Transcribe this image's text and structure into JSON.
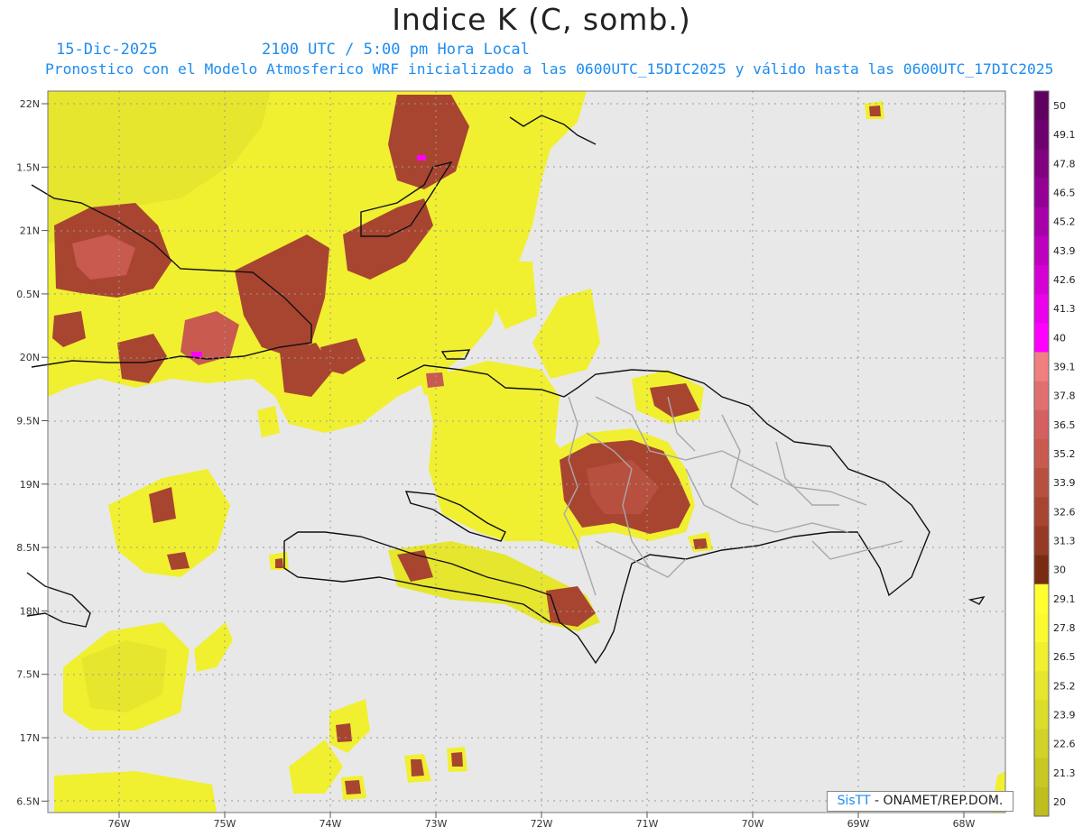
{
  "header": {
    "title": "Indice K (C, somb.)",
    "date": "15-Dic-2025",
    "time": "2100 UTC / 5:00 pm Hora Local",
    "description": "Pronostico con el Modelo Atmosferico WRF inicializado a las 0600UTC_15DIC2025 y válido hasta las  0600UTC_17DIC2025"
  },
  "map": {
    "lat_labels": [
      "22N",
      "1.5N",
      "21N",
      "0.5N",
      "20N",
      "9.5N",
      "19N",
      "8.5N",
      "18N",
      "7.5N",
      "17N",
      "6.5N"
    ],
    "lon_labels": [
      "76W",
      "75W",
      "74W",
      "73W",
      "72W",
      "71W",
      "70W",
      "69W",
      "68W"
    ],
    "background_color": "#e8e8e8"
  },
  "colorbar": {
    "levels": [
      "50",
      "49.1",
      "47.8",
      "46.5",
      "45.2",
      "43.9",
      "42.6",
      "41.3",
      "40",
      "39.1",
      "37.8",
      "36.5",
      "35.2",
      "33.9",
      "32.6",
      "31.3",
      "30",
      "29.1",
      "27.8",
      "26.5",
      "25.2",
      "23.9",
      "22.6",
      "21.3",
      "20"
    ],
    "colors": [
      "#600060",
      "#6e0070",
      "#800080",
      "#930093",
      "#a800a8",
      "#bd00bd",
      "#d400d4",
      "#ea00ea",
      "#ff00ff",
      "#f08080",
      "#e07070",
      "#d46060",
      "#c85a50",
      "#b8503f",
      "#a84530",
      "#963a25",
      "#7a2c12",
      "#ffff30",
      "#fafa30",
      "#f0f030",
      "#e6e62e",
      "#dcdc2a",
      "#d2d228",
      "#c8c824",
      "#bebe1e"
    ]
  },
  "credit": {
    "brand": "SisTT",
    "text": " - ONAMET/REP.DOM."
  }
}
